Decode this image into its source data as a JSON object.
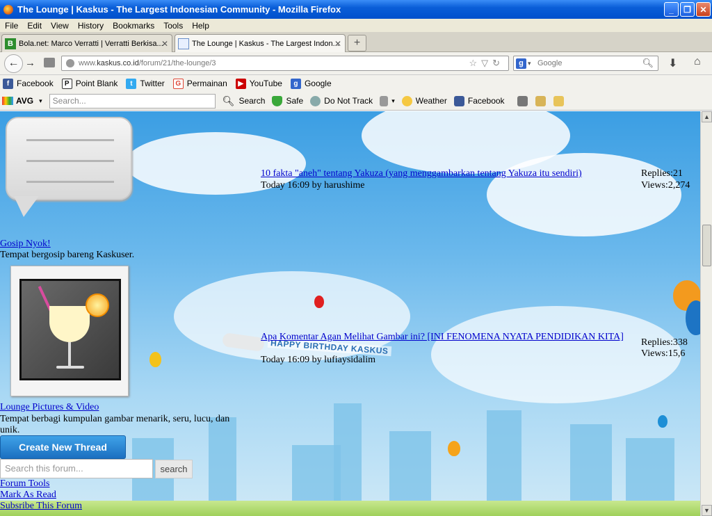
{
  "window": {
    "title": "The Lounge | Kaskus - The Largest Indonesian Community - Mozilla Firefox"
  },
  "menu": [
    "File",
    "Edit",
    "View",
    "History",
    "Bookmarks",
    "Tools",
    "Help"
  ],
  "tabs": [
    {
      "label": "Bola.net: Marco Verratti | Verratti Berkisa...",
      "icon": "B"
    },
    {
      "label": "The Lounge | Kaskus - The Largest Indon...",
      "icon": ""
    }
  ],
  "url": {
    "prefix": "www.",
    "host": "kaskus.co.id",
    "path": "/forum/21/the-lounge/3"
  },
  "search_engine": {
    "placeholder": "Google",
    "icon": "g"
  },
  "bookmarks": [
    {
      "label": "Facebook",
      "icon": "f",
      "color": "#3b5998"
    },
    {
      "label": "Point Blank",
      "icon": "P",
      "color": "#222222"
    },
    {
      "label": "Twitter",
      "icon": "t",
      "color": "#33aaf0"
    },
    {
      "label": "Permainan",
      "icon": "G",
      "color": "#dd4433"
    },
    {
      "label": "YouTube",
      "icon": "▶",
      "color": "#cc0000"
    },
    {
      "label": "Google",
      "icon": "g",
      "color": "#3366cc"
    }
  ],
  "avg_toolbar": {
    "brand": "AVG",
    "search_placeholder": "Search...",
    "search_button": "Search",
    "safe": "Safe",
    "do_not_track": "Do Not Track",
    "weather": "Weather",
    "facebook": "Facebook"
  },
  "sidebar": {
    "forums": [
      {
        "title": "Gosip Nyok!",
        "description": "Tempat bergosip bareng Kaskuser."
      },
      {
        "title": "Lounge Pictures & Video",
        "description": "Tempat berbagi kumpulan gambar menarik, seru, lucu, dan unik."
      }
    ],
    "create_thread": "Create New Thread",
    "search_placeholder": "Search this forum...",
    "search_button": "search",
    "links": [
      "Forum Tools",
      "Mark As Read",
      "Subsribe This Forum"
    ]
  },
  "threads": [
    {
      "title": "10 fakta \"aneh\" tentang Yakuza (yang menggambarkan tentang Yakuza itu sendiri)",
      "meta": "Today 16:09 by harushime",
      "replies": "Replies:21",
      "views": "Views:2,274"
    },
    {
      "title": "Apa Komentar Agan Melihat Gambar ini? [INI FENOMENA NYATA PENDIDIKAN KITA]",
      "meta": "Today 16:09 by lufiaysidalim",
      "replies": "Replies:338",
      "views": "Views:15,6"
    }
  ],
  "banner_text": "HAPPY BIRTHDAY KASKUS",
  "colors": {
    "link": "#0000cc",
    "button": "#1b6fc0",
    "titlebar": "#0a5ed8",
    "sky": "#6ab8ec"
  }
}
